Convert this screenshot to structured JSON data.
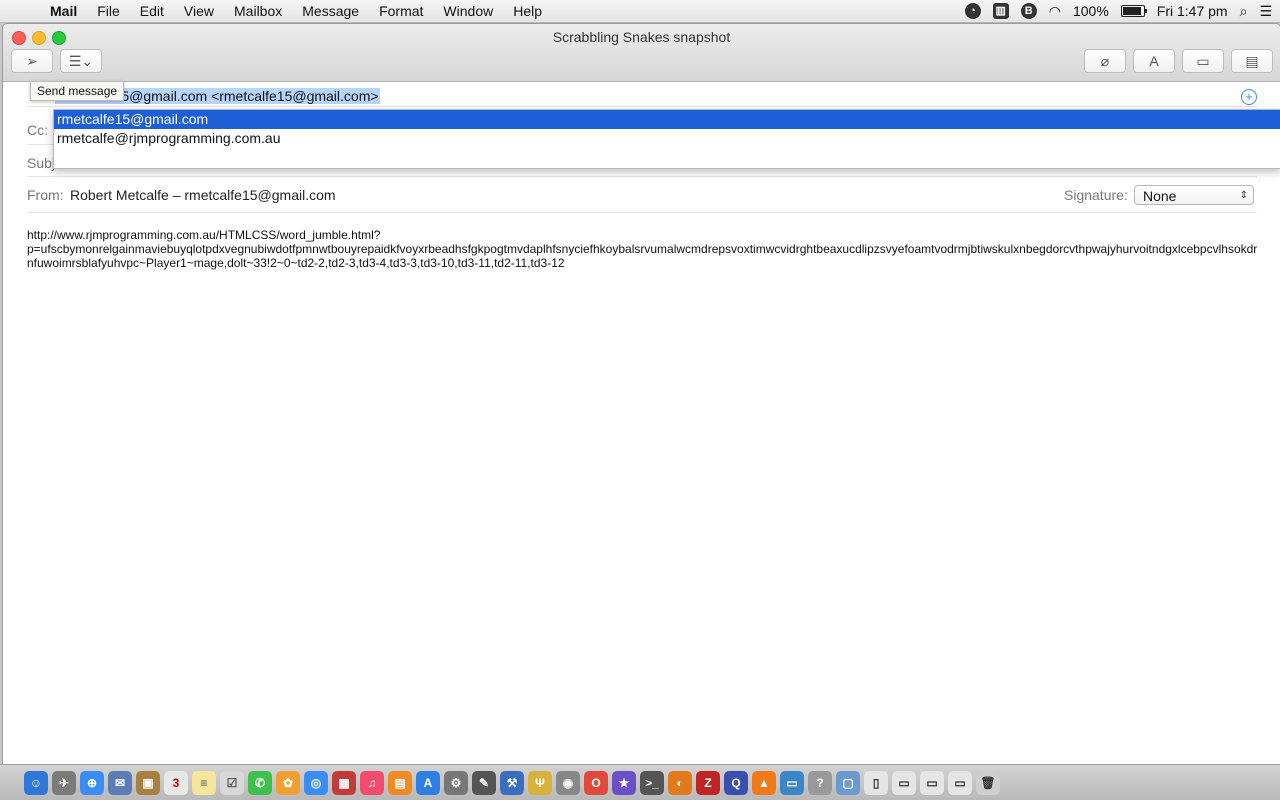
{
  "menubar": {
    "app": "Mail",
    "items": [
      "File",
      "Edit",
      "View",
      "Mailbox",
      "Message",
      "Format",
      "Window",
      "Help"
    ],
    "battery": "100%",
    "battery_level": 1.0,
    "clock": "Fri 1:47 pm"
  },
  "window": {
    "title": "Scrabbling Snakes snapshot",
    "tooltip": "Send message",
    "to_value": "rmetcalfe15@gmail.com <rmetcalfe15@gmail.com>",
    "cc_label": "Cc:",
    "subject_label": "Subj",
    "from_label": "From:",
    "from_value": "Robert Metcalfe – rmetcalfe15@gmail.com",
    "signature_label": "Signature:",
    "signature_value": "None",
    "autocomplete": [
      "rmetcalfe15@gmail.com",
      "rmetcalfe@rjmprogramming.com.au"
    ],
    "body": "http://www.rjmprogramming.com.au/HTMLCSS/word_jumble.html?\np=ufscbymonrelgainmaviebuyqlotpdxvegnubiwdotfpmnwtbouyrepaidkfvoyxrbeadhsfgkpogtmvdaplhfsnyciefhkoybalsrvumalwcmdrepsvoxtimwcvidrghtbeaxucdlipzsvyefoamtvodrmjbtiwskulxnbegdorcvthpwajyhurvoitndgxlcebpcvlhsokdrnfuwoimrsblafyuhvpc~Player1~mage,dolt~33!2~0~td2-2,td2-3,td3-4,td3-3,td3-10,td3-11,td2-11,td3-12"
  },
  "colors": {
    "selection": "#b5d5fd",
    "dropdown_selected": "#1d5fd6",
    "accent": "#3b8cf5"
  },
  "icons": {
    "menubar_right": [
      "timer-icon",
      "sidebar-icon",
      "bold-b-icon",
      "wifi-icon",
      "battery-icon",
      "spotlight-search-icon",
      "notification-list-icon"
    ],
    "toolbar": [
      "send-icon",
      "header-fields-icon",
      "attachment-icon",
      "format-font-icon",
      "photo-browser-icon",
      "stationery-icon"
    ]
  }
}
